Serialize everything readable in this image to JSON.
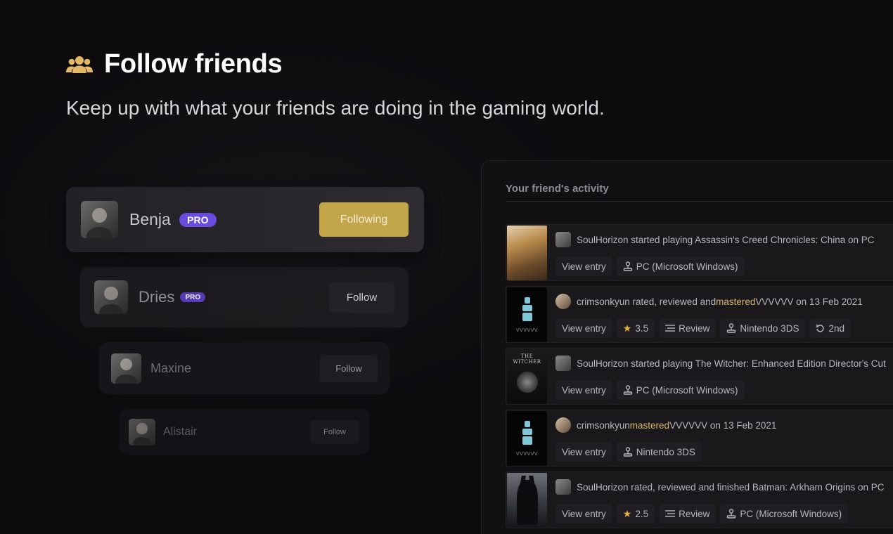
{
  "hero": {
    "icon": "users-icon",
    "title": "Follow friends",
    "subtitle": "Keep up with what your friends are doing in the gaming world."
  },
  "colors": {
    "accent_gold": "#c2a548",
    "pro_purple": "#6a4be0",
    "highlight": "#d8b56a",
    "star": "#e5b33a"
  },
  "friends": [
    {
      "name": "Benja",
      "pro": "PRO",
      "button": "Following"
    },
    {
      "name": "Dries",
      "pro": "PRO",
      "button": "Follow"
    },
    {
      "name": "Maxine",
      "button": "Follow"
    },
    {
      "name": "Alistair",
      "button": "Follow"
    }
  ],
  "activity": {
    "title": "Your friend's activity",
    "entries": [
      {
        "cover_icon": "assassins-creed-cover",
        "user": "SoulHorizon",
        "text_pre": "SoulHorizon started playing Assassin's Creed Chronicles: China on PC",
        "view": "View entry",
        "platform": "PC (Microsoft Windows)"
      },
      {
        "cover_icon": "vvvvvv-cover",
        "cover_caption": "VVVVVV",
        "user": "crimsonkyun",
        "text_pre": "crimsonkyun rated, reviewed and ",
        "text_hl": "mastered",
        "text_post": " VVVVVV on 13 Feb 2021",
        "view": "View entry",
        "rating": "3.5",
        "review": "Review",
        "platform": "Nintendo 3DS",
        "replay": "2nd"
      },
      {
        "cover_icon": "witcher-cover",
        "cover_caption": "THE WITCHER",
        "user": "SoulHorizon",
        "text_pre": "SoulHorizon started playing The Witcher: Enhanced Edition Director's Cut",
        "view": "View entry",
        "platform": "PC (Microsoft Windows)"
      },
      {
        "cover_icon": "vvvvvv-cover",
        "cover_caption": "VVVVVV",
        "user": "crimsonkyun",
        "text_pre": "crimsonkyun ",
        "text_hl": "mastered",
        "text_post": " VVVVVV on 13 Feb 2021",
        "view": "View entry",
        "platform": "Nintendo 3DS"
      },
      {
        "cover_icon": "batman-arkham-origins-cover",
        "user": "SoulHorizon",
        "text_pre": "SoulHorizon rated, reviewed and finished Batman: Arkham Origins on PC",
        "view": "View entry",
        "rating": "2.5",
        "review": "Review",
        "platform": "PC (Microsoft Windows)"
      }
    ]
  }
}
